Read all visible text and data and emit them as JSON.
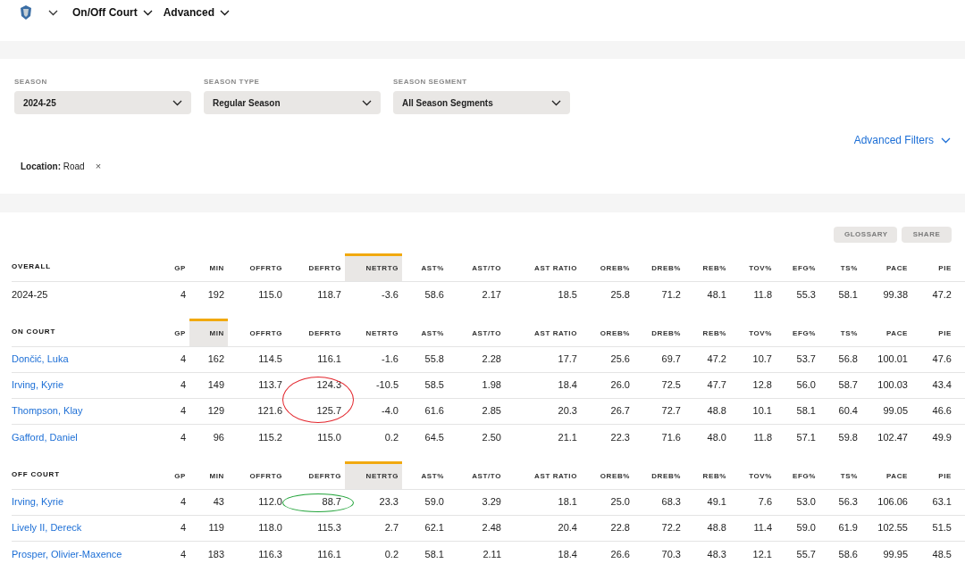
{
  "nav": {
    "items": [
      {
        "label": "On/Off Court"
      },
      {
        "label": "Advanced"
      }
    ]
  },
  "filters": [
    {
      "label": "SEASON",
      "value": "2024-25"
    },
    {
      "label": "SEASON TYPE",
      "value": "Regular Season"
    },
    {
      "label": "SEASON SEGMENT",
      "value": "All Season Segments"
    }
  ],
  "advanced_filters": "Advanced Filters",
  "active_filter": {
    "label": "Location:",
    "value": "Road",
    "remove": "×"
  },
  "buttons": [
    "GLOSSARY",
    "SHARE"
  ],
  "sections": [
    {
      "title": "OVERALL",
      "columns": [
        {
          "label": "GP",
          "selected": false
        },
        {
          "label": "MIN",
          "selected": false
        },
        {
          "label": "OFFRTG",
          "selected": false
        },
        {
          "label": "DEFRTG",
          "selected": false
        },
        {
          "label": "NETRTG",
          "selected": true
        },
        {
          "label": "AST%",
          "selected": false
        },
        {
          "label": "AST/TO",
          "selected": false
        },
        {
          "label": "AST RATIO",
          "selected": false
        },
        {
          "label": "OREB%",
          "selected": false
        },
        {
          "label": "DREB%",
          "selected": false
        },
        {
          "label": "REB%",
          "selected": false
        },
        {
          "label": "TOV%",
          "selected": false
        },
        {
          "label": "EFG%",
          "selected": false
        },
        {
          "label": "TS%",
          "selected": false
        },
        {
          "label": "PACE",
          "selected": false
        },
        {
          "label": "PIE",
          "selected": false
        }
      ],
      "rows": [
        {
          "kind": "season",
          "name": "2024-25",
          "cells": [
            "4",
            "192",
            "115.0",
            "118.7",
            "-3.6",
            "58.6",
            "2.17",
            "18.5",
            "25.8",
            "71.2",
            "48.1",
            "11.8",
            "55.3",
            "58.1",
            "99.38",
            "47.2"
          ]
        }
      ]
    },
    {
      "title": "ON COURT",
      "columns": [
        {
          "label": "GP",
          "selected": false
        },
        {
          "label": "MIN",
          "selected": true
        },
        {
          "label": "OFFRTG",
          "selected": false
        },
        {
          "label": "DEFRTG",
          "selected": false
        },
        {
          "label": "NETRTG",
          "selected": false
        },
        {
          "label": "AST%",
          "selected": false
        },
        {
          "label": "AST/TO",
          "selected": false
        },
        {
          "label": "AST RATIO",
          "selected": false
        },
        {
          "label": "OREB%",
          "selected": false
        },
        {
          "label": "DREB%",
          "selected": false
        },
        {
          "label": "REB%",
          "selected": false
        },
        {
          "label": "TOV%",
          "selected": false
        },
        {
          "label": "EFG%",
          "selected": false
        },
        {
          "label": "TS%",
          "selected": false
        },
        {
          "label": "PACE",
          "selected": false
        },
        {
          "label": "PIE",
          "selected": false
        }
      ],
      "rows": [
        {
          "kind": "player",
          "name": "Dončić, Luka",
          "cells": [
            "4",
            "162",
            "114.5",
            "116.1",
            "-1.6",
            "55.8",
            "2.28",
            "17.7",
            "25.6",
            "69.7",
            "47.2",
            "10.7",
            "53.7",
            "56.8",
            "100.01",
            "47.6"
          ]
        },
        {
          "kind": "player",
          "name": "Irving, Kyrie",
          "color": "#e3262d",
          "cells": [
            "4",
            "149",
            "113.7",
            "124.3",
            "-10.5",
            "58.5",
            "1.98",
            "18.4",
            "26.0",
            "72.5",
            "47.7",
            "12.8",
            "56.0",
            "58.7",
            "100.03",
            "43.4"
          ]
        },
        {
          "kind": "player",
          "name": "Thompson, Klay",
          "color": "#e3262d",
          "cells": [
            "4",
            "129",
            "121.6",
            "125.7",
            "-4.0",
            "61.6",
            "2.85",
            "20.3",
            "26.7",
            "72.7",
            "48.8",
            "10.1",
            "58.1",
            "60.4",
            "99.05",
            "46.6"
          ]
        },
        {
          "kind": "player",
          "name": "Gafford, Daniel",
          "cells": [
            "4",
            "96",
            "115.2",
            "115.0",
            "0.2",
            "64.5",
            "2.50",
            "21.1",
            "22.3",
            "71.6",
            "48.0",
            "11.8",
            "57.1",
            "59.8",
            "102.47",
            "49.9"
          ]
        }
      ]
    },
    {
      "title": "OFF COURT",
      "columns": [
        {
          "label": "GP",
          "selected": false
        },
        {
          "label": "MIN",
          "selected": false
        },
        {
          "label": "OFFRTG",
          "selected": false
        },
        {
          "label": "DEFRTG",
          "selected": false
        },
        {
          "label": "NETRTG",
          "selected": true
        },
        {
          "label": "AST%",
          "selected": false
        },
        {
          "label": "AST/TO",
          "selected": false
        },
        {
          "label": "AST RATIO",
          "selected": false
        },
        {
          "label": "OREB%",
          "selected": false
        },
        {
          "label": "DREB%",
          "selected": false
        },
        {
          "label": "REB%",
          "selected": false
        },
        {
          "label": "TOV%",
          "selected": false
        },
        {
          "label": "EFG%",
          "selected": false
        },
        {
          "label": "TS%",
          "selected": false
        },
        {
          "label": "PACE",
          "selected": false
        },
        {
          "label": "PIE",
          "selected": false
        }
      ],
      "rows": [
        {
          "kind": "player",
          "name": "Irving, Kyrie",
          "color": "#22a43a",
          "cells": [
            "4",
            "43",
            "112.0",
            "88.7",
            "23.3",
            "59.0",
            "3.29",
            "18.1",
            "25.0",
            "68.3",
            "49.1",
            "7.6",
            "53.0",
            "56.3",
            "106.06",
            "63.1"
          ]
        },
        {
          "kind": "player",
          "name": "Lively II, Dereck",
          "cells": [
            "4",
            "119",
            "118.0",
            "115.3",
            "2.7",
            "62.1",
            "2.48",
            "20.4",
            "22.8",
            "72.2",
            "48.8",
            "11.4",
            "59.0",
            "61.9",
            "102.55",
            "51.5"
          ]
        },
        {
          "kind": "player",
          "name": "Prosper, Olivier-Maxence",
          "cells": [
            "4",
            "183",
            "116.3",
            "116.1",
            "0.2",
            "58.1",
            "2.11",
            "18.4",
            "26.6",
            "70.3",
            "48.3",
            "12.1",
            "55.7",
            "58.6",
            "99.95",
            "48.5"
          ]
        }
      ]
    }
  ]
}
